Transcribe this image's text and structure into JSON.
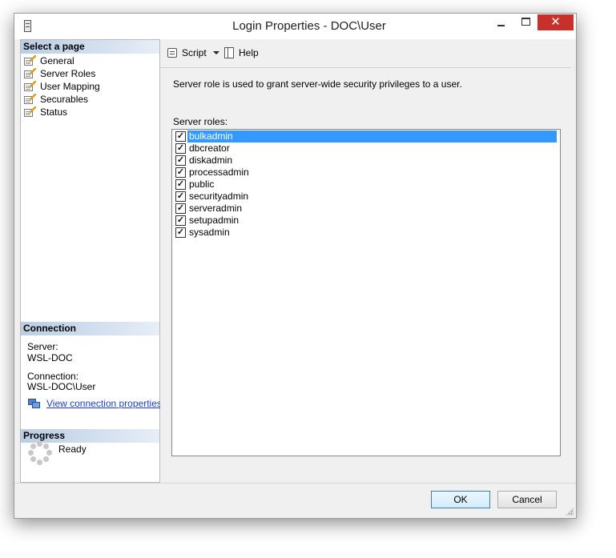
{
  "window": {
    "title": "Login Properties - DOC\\User",
    "close_glyph": "✕"
  },
  "sidebar": {
    "select_page_header": "Select a page",
    "pages": [
      {
        "label": "General",
        "selected": false
      },
      {
        "label": "Server Roles",
        "selected": true
      },
      {
        "label": "User Mapping",
        "selected": false
      },
      {
        "label": "Securables",
        "selected": false
      },
      {
        "label": "Status",
        "selected": false
      }
    ],
    "connection": {
      "header": "Connection",
      "server_label": "Server:",
      "server_value": "WSL-DOC",
      "connection_label": "Connection:",
      "connection_value": "WSL-DOC\\User",
      "view_link": "View connection properties"
    },
    "progress": {
      "header": "Progress",
      "status": "Ready"
    }
  },
  "toolbar": {
    "script_label": "Script",
    "help_label": "Help"
  },
  "main": {
    "description": "Server role is used to grant server-wide security privileges to a user.",
    "roles_label": "Server roles:",
    "roles": [
      {
        "name": "bulkadmin",
        "checked": true,
        "selected": true
      },
      {
        "name": "dbcreator",
        "checked": true,
        "selected": false
      },
      {
        "name": "diskadmin",
        "checked": true,
        "selected": false
      },
      {
        "name": "processadmin",
        "checked": true,
        "selected": false
      },
      {
        "name": "public",
        "checked": true,
        "selected": false
      },
      {
        "name": "securityadmin",
        "checked": true,
        "selected": false
      },
      {
        "name": "serveradmin",
        "checked": true,
        "selected": false
      },
      {
        "name": "setupadmin",
        "checked": true,
        "selected": false
      },
      {
        "name": "sysadmin",
        "checked": true,
        "selected": false
      }
    ]
  },
  "footer": {
    "ok_label": "OK",
    "cancel_label": "Cancel"
  },
  "colors": {
    "selection": "#3399ff",
    "close_button": "#c7302b",
    "link": "#1f3fd0"
  }
}
